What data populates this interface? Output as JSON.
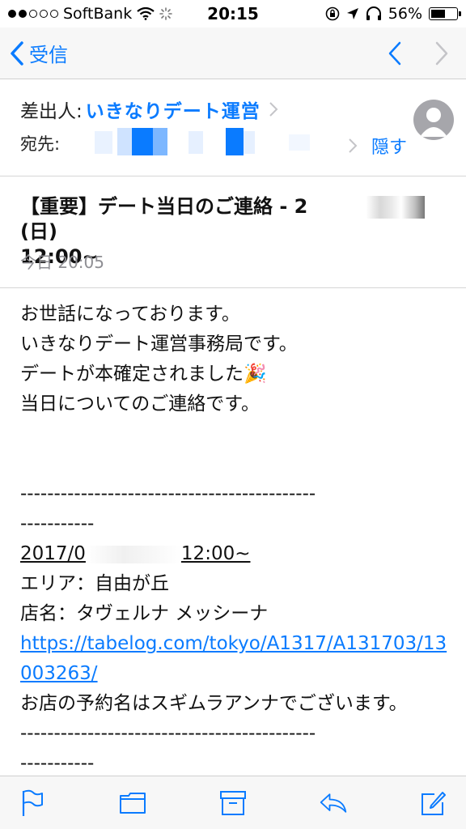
{
  "status_bar": {
    "carrier": "SoftBank",
    "time": "20:15",
    "battery": "56%"
  },
  "nav": {
    "back_label": "受信"
  },
  "header": {
    "from_label": "差出人:",
    "from_name": "いきなりデート運営",
    "to_label": "宛先:",
    "hide_label": "隠す"
  },
  "subject": {
    "part1": "【重要】デート当日のご連絡 - 2",
    "part2": "(日)",
    "part3": "12:00~",
    "date": "今日 20:05"
  },
  "body": {
    "line1": "お世話になっております。",
    "line2": "いきなりデート運営事務局です。",
    "line3": "デートが本確定されました🎉",
    "line4": "当日についてのご連絡です。",
    "dashes_long": "--------------------------------------------",
    "dashes_short": "-----------",
    "date_prefix": "2017/0",
    "date_suffix": "12:00~",
    "area": "エリア：自由が丘",
    "shop": "店名：タヴェルナ メッシーナ",
    "url": "https://tabelog.com/tokyo/A1317/A131703/13003263/",
    "reservation": "お店の予約名はスギムラアンナでございます。"
  },
  "colors": {
    "accent": "#0a7bff",
    "secondary_text": "#8e8e93",
    "bar_background": "#f7f7f7"
  },
  "icons": [
    "signal-dots-icon",
    "wifi-icon",
    "activity-icon",
    "orientation-lock-icon",
    "location-icon",
    "headphones-icon",
    "battery-icon",
    "back-chevron-icon",
    "up-arrow-icon",
    "down-arrow-icon",
    "avatar-icon",
    "flag-icon",
    "folder-icon",
    "archive-icon",
    "reply-icon",
    "compose-icon"
  ]
}
